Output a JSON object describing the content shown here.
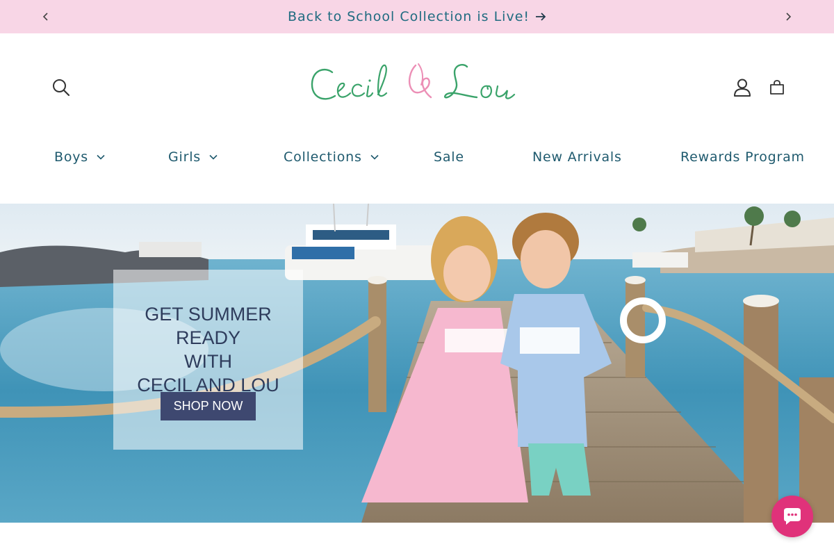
{
  "announcement": {
    "text": "Back to School Collection is Live!",
    "arrow_icon": "arrow-right-icon",
    "prev_icon": "chevron-left-icon",
    "next_icon": "chevron-right-icon",
    "background": "#f8d6e6"
  },
  "header": {
    "logo_text": "Cecil & Lou",
    "icons": [
      "search-icon",
      "account-icon",
      "cart-icon"
    ]
  },
  "nav": {
    "items": [
      {
        "label": "Boys",
        "dropdown": true
      },
      {
        "label": "Girls",
        "dropdown": true
      },
      {
        "label": "Collections",
        "dropdown": true
      },
      {
        "label": "Sale",
        "dropdown": false
      },
      {
        "label": "New Arrivals",
        "dropdown": false
      },
      {
        "label": "Rewards Program",
        "dropdown": false
      }
    ]
  },
  "hero": {
    "heading_lines": [
      "GET SUMMER READY",
      "WITH",
      "CECIL AND LOU"
    ],
    "button_label": "SHOP NOW",
    "button_color": "#3e4870"
  },
  "chat": {
    "icon": "chat-bubble-icon",
    "color": "#e0327a"
  }
}
